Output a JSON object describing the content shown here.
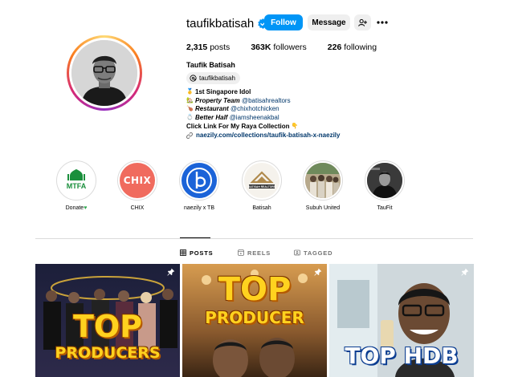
{
  "profile": {
    "username": "taufikbatisah",
    "verified": true,
    "follow_label": "Follow",
    "message_label": "Message",
    "stats": {
      "posts_value": "2,315",
      "posts_label": "posts",
      "followers_value": "363K",
      "followers_label": "followers",
      "following_value": "226",
      "following_label": "following"
    },
    "full_name": "Taufik Batisah",
    "threads_handle": "taufikbatisah",
    "bio": {
      "line1": "1st Singapore Idol",
      "line2_label": "Property Team",
      "line2_mention": "@batisahrealtors",
      "line3_label": "Restaurant",
      "line3_mention": "@chixhotchicken",
      "line4_label": "Better Half",
      "line4_mention": "@iamsheenakbal",
      "line5": "Click Link For My Raya Collection",
      "link": "naezily.com/collections/taufik-batisah-x-naezily"
    }
  },
  "highlights": [
    {
      "label": "Donate",
      "art_text": "MTFA"
    },
    {
      "label": "CHIX",
      "art_text": "CHIX"
    },
    {
      "label": "naezily x TB",
      "art_text": ""
    },
    {
      "label": "Batisah",
      "art_text": "BATISAH REALTORS"
    },
    {
      "label": "Subuh United",
      "art_text": ""
    },
    {
      "label": "TauFit",
      "art_text": ""
    }
  ],
  "tabs": [
    {
      "label": "POSTS",
      "active": true
    },
    {
      "label": "REELS",
      "active": false
    },
    {
      "label": "TAGGED",
      "active": false
    }
  ],
  "posts": [
    {
      "headline_1": "TOP",
      "headline_2": "PRODUCERS",
      "pinned": true
    },
    {
      "headline_1": "TOP",
      "headline_2": "PRODUCER",
      "pinned": true
    },
    {
      "headline_1": "TOP HDB",
      "headline_2": "",
      "pinned": true
    }
  ],
  "colors": {
    "follow_blue": "#0095f6",
    "link_blue": "#00376b",
    "button_grey": "#efefef",
    "divider": "#dbdbdb",
    "headline_yellow": "#ffd21f"
  }
}
